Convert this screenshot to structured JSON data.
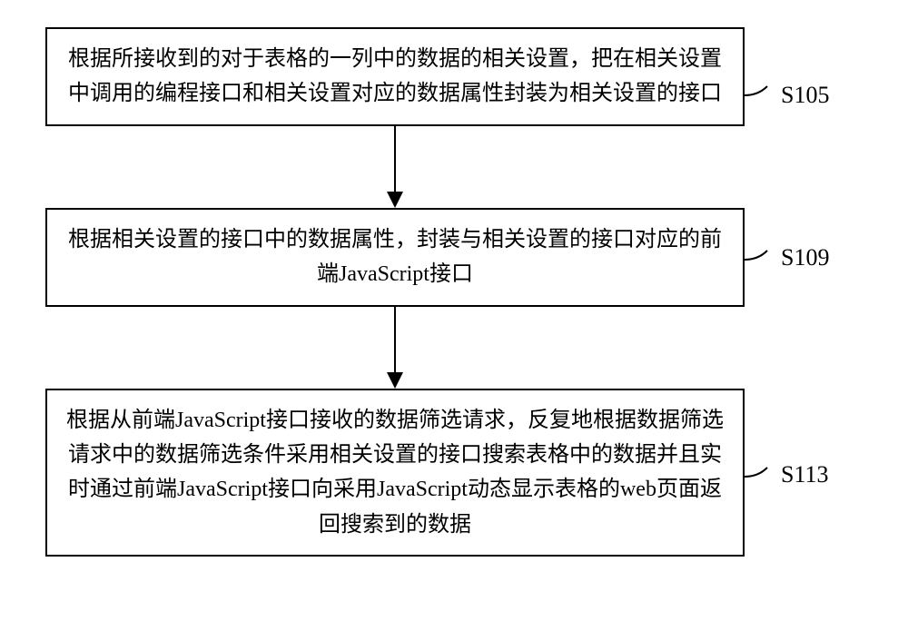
{
  "flowchart": {
    "steps": [
      {
        "id": "S105",
        "text": "根据所接收到的对于表格的一列中的数据的相关设置，把在相关设置中调用的编程接口和相关设置对应的数据属性封装为相关设置的接口"
      },
      {
        "id": "S109",
        "text": "根据相关设置的接口中的数据属性，封装与相关设置的接口对应的前端JavaScript接口"
      },
      {
        "id": "S113",
        "text": "根据从前端JavaScript接口接收的数据筛选请求，反复地根据数据筛选请求中的数据筛选条件采用相关设置的接口搜索表格中的数据并且实时通过前端JavaScript接口向采用JavaScript动态显示表格的web页面返回搜索到的数据"
      }
    ]
  }
}
